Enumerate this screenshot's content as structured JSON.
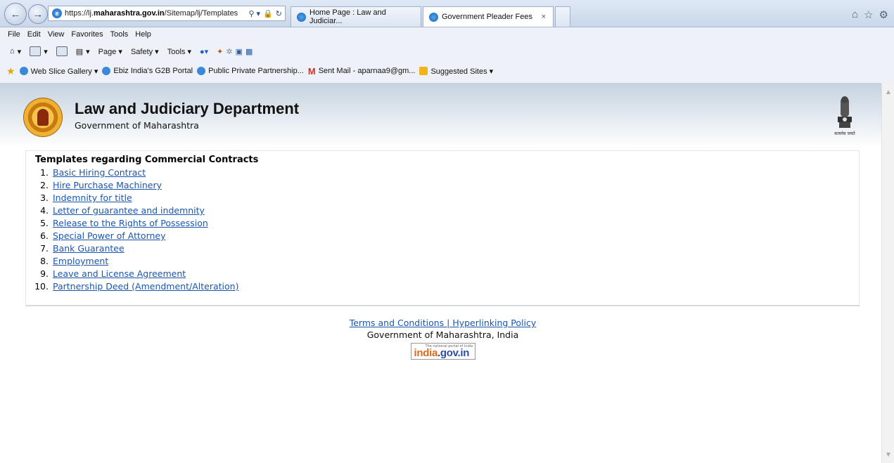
{
  "browser": {
    "address": {
      "prefix": "https://lj.",
      "domain": "maharashtra.gov.in",
      "path": "/Sitemap/lj/Templates"
    },
    "tabs": [
      {
        "label": "Home Page : Law and Judiciar..."
      },
      {
        "label": "Government Pleader Fees",
        "close": "×"
      }
    ],
    "menu": [
      "File",
      "Edit",
      "View",
      "Favorites",
      "Tools",
      "Help"
    ],
    "commands": {
      "page": "Page ▾",
      "safety": "Safety ▾",
      "tools": "Tools ▾"
    },
    "favorites": [
      {
        "label": "Web Slice Gallery ▾"
      },
      {
        "label": "Ebiz India's G2B Portal"
      },
      {
        "label": "Public Private Partnership..."
      },
      {
        "label": "Sent Mail - aparnaa9@gm..."
      },
      {
        "label": "Suggested Sites ▾"
      }
    ]
  },
  "header": {
    "title": "Law and Judiciary Department",
    "subtitle": "Government of Maharashtra",
    "emblem_motto": "सत्यमेव जयते"
  },
  "content": {
    "heading": "Templates regarding Commercial Contracts",
    "items": [
      {
        "num": "1.",
        "label": "Basic Hiring Contract"
      },
      {
        "num": "2.",
        "label": "Hire Purchase Machinery"
      },
      {
        "num": "3.",
        "label": "Indemnity for title"
      },
      {
        "num": "4.",
        "label": "Letter of guarantee and indemnity"
      },
      {
        "num": "5.",
        "label": "Release to the Rights of Possession"
      },
      {
        "num": "6.",
        "label": "Special Power of Attorney"
      },
      {
        "num": "7.",
        "label": "Bank Guarantee"
      },
      {
        "num": "8.",
        "label": "Employment"
      },
      {
        "num": "9.",
        "label": "Leave and License Agreement"
      },
      {
        "num": "10.",
        "label": "Partnership Deed (Amendment/Alteration)"
      }
    ]
  },
  "footer": {
    "links": "Terms and Conditions | Hyperlinking Policy",
    "government": "Government of Maharashtra, India",
    "portal_tagline": "The national portal of India",
    "portal_name_a": "india",
    "portal_name_b": ".gov.in"
  }
}
